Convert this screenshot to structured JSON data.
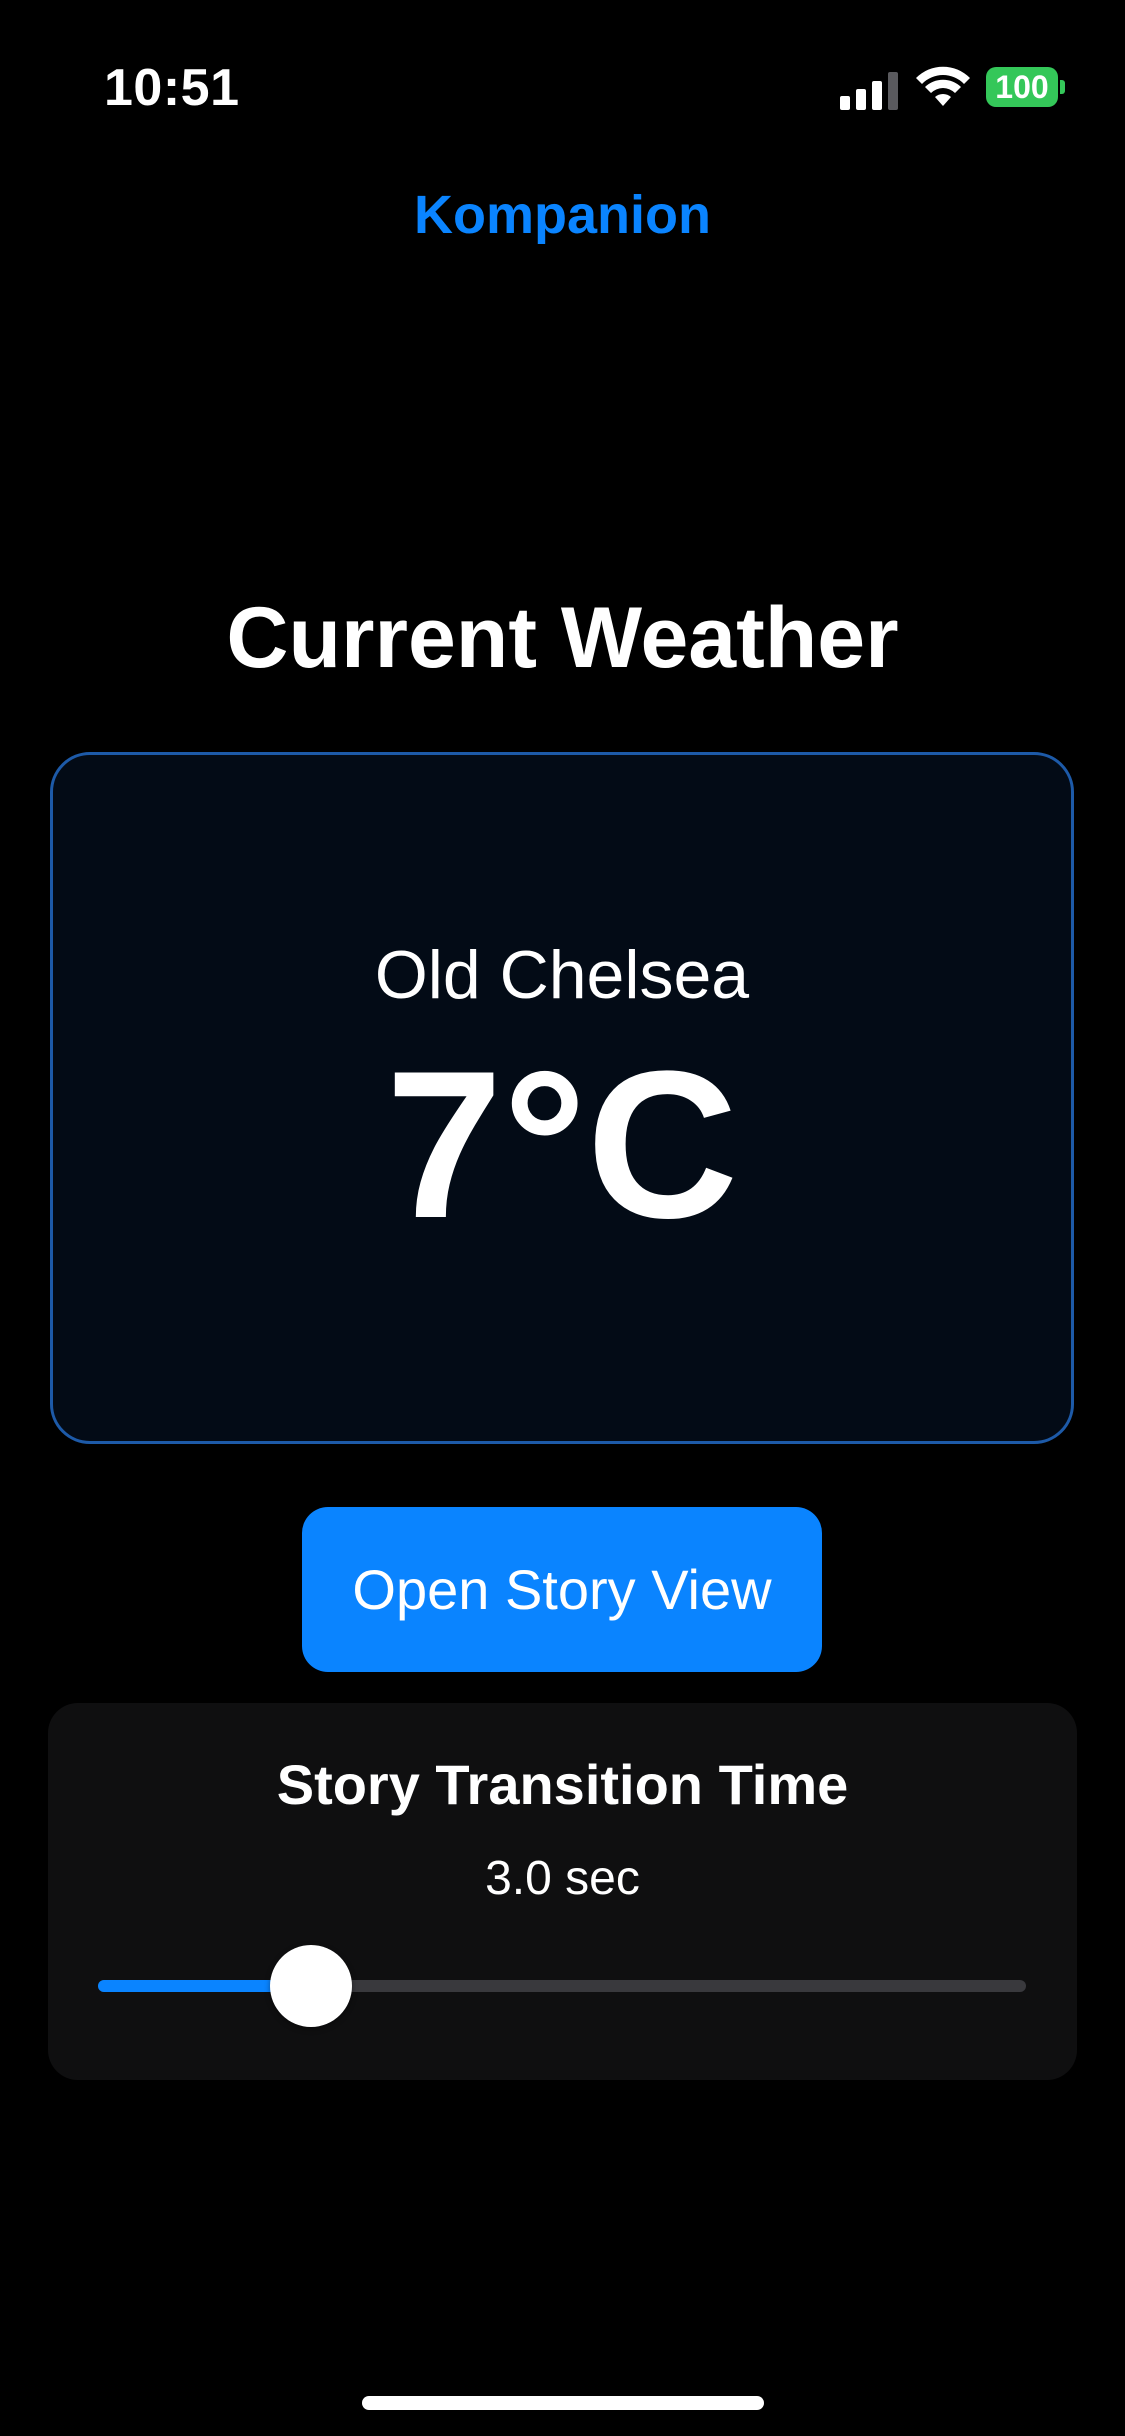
{
  "status_bar": {
    "time": "10:51",
    "battery_level": "100",
    "signal_icon": "cellular-signal-icon",
    "wifi_icon": "wifi-icon",
    "battery_color": "#34c759"
  },
  "nav": {
    "title": "Kompanion",
    "accent_color": "#0a84ff"
  },
  "main": {
    "heading": "Current Weather",
    "weather": {
      "location": "Old Chelsea",
      "temperature": "7°C",
      "card_border_color": "#1d5aa8"
    },
    "open_story_button_label": "Open Story View",
    "story_transition": {
      "title": "Story Transition Time",
      "value_label": "3.0 sec",
      "slider_fraction": 0.23
    }
  }
}
